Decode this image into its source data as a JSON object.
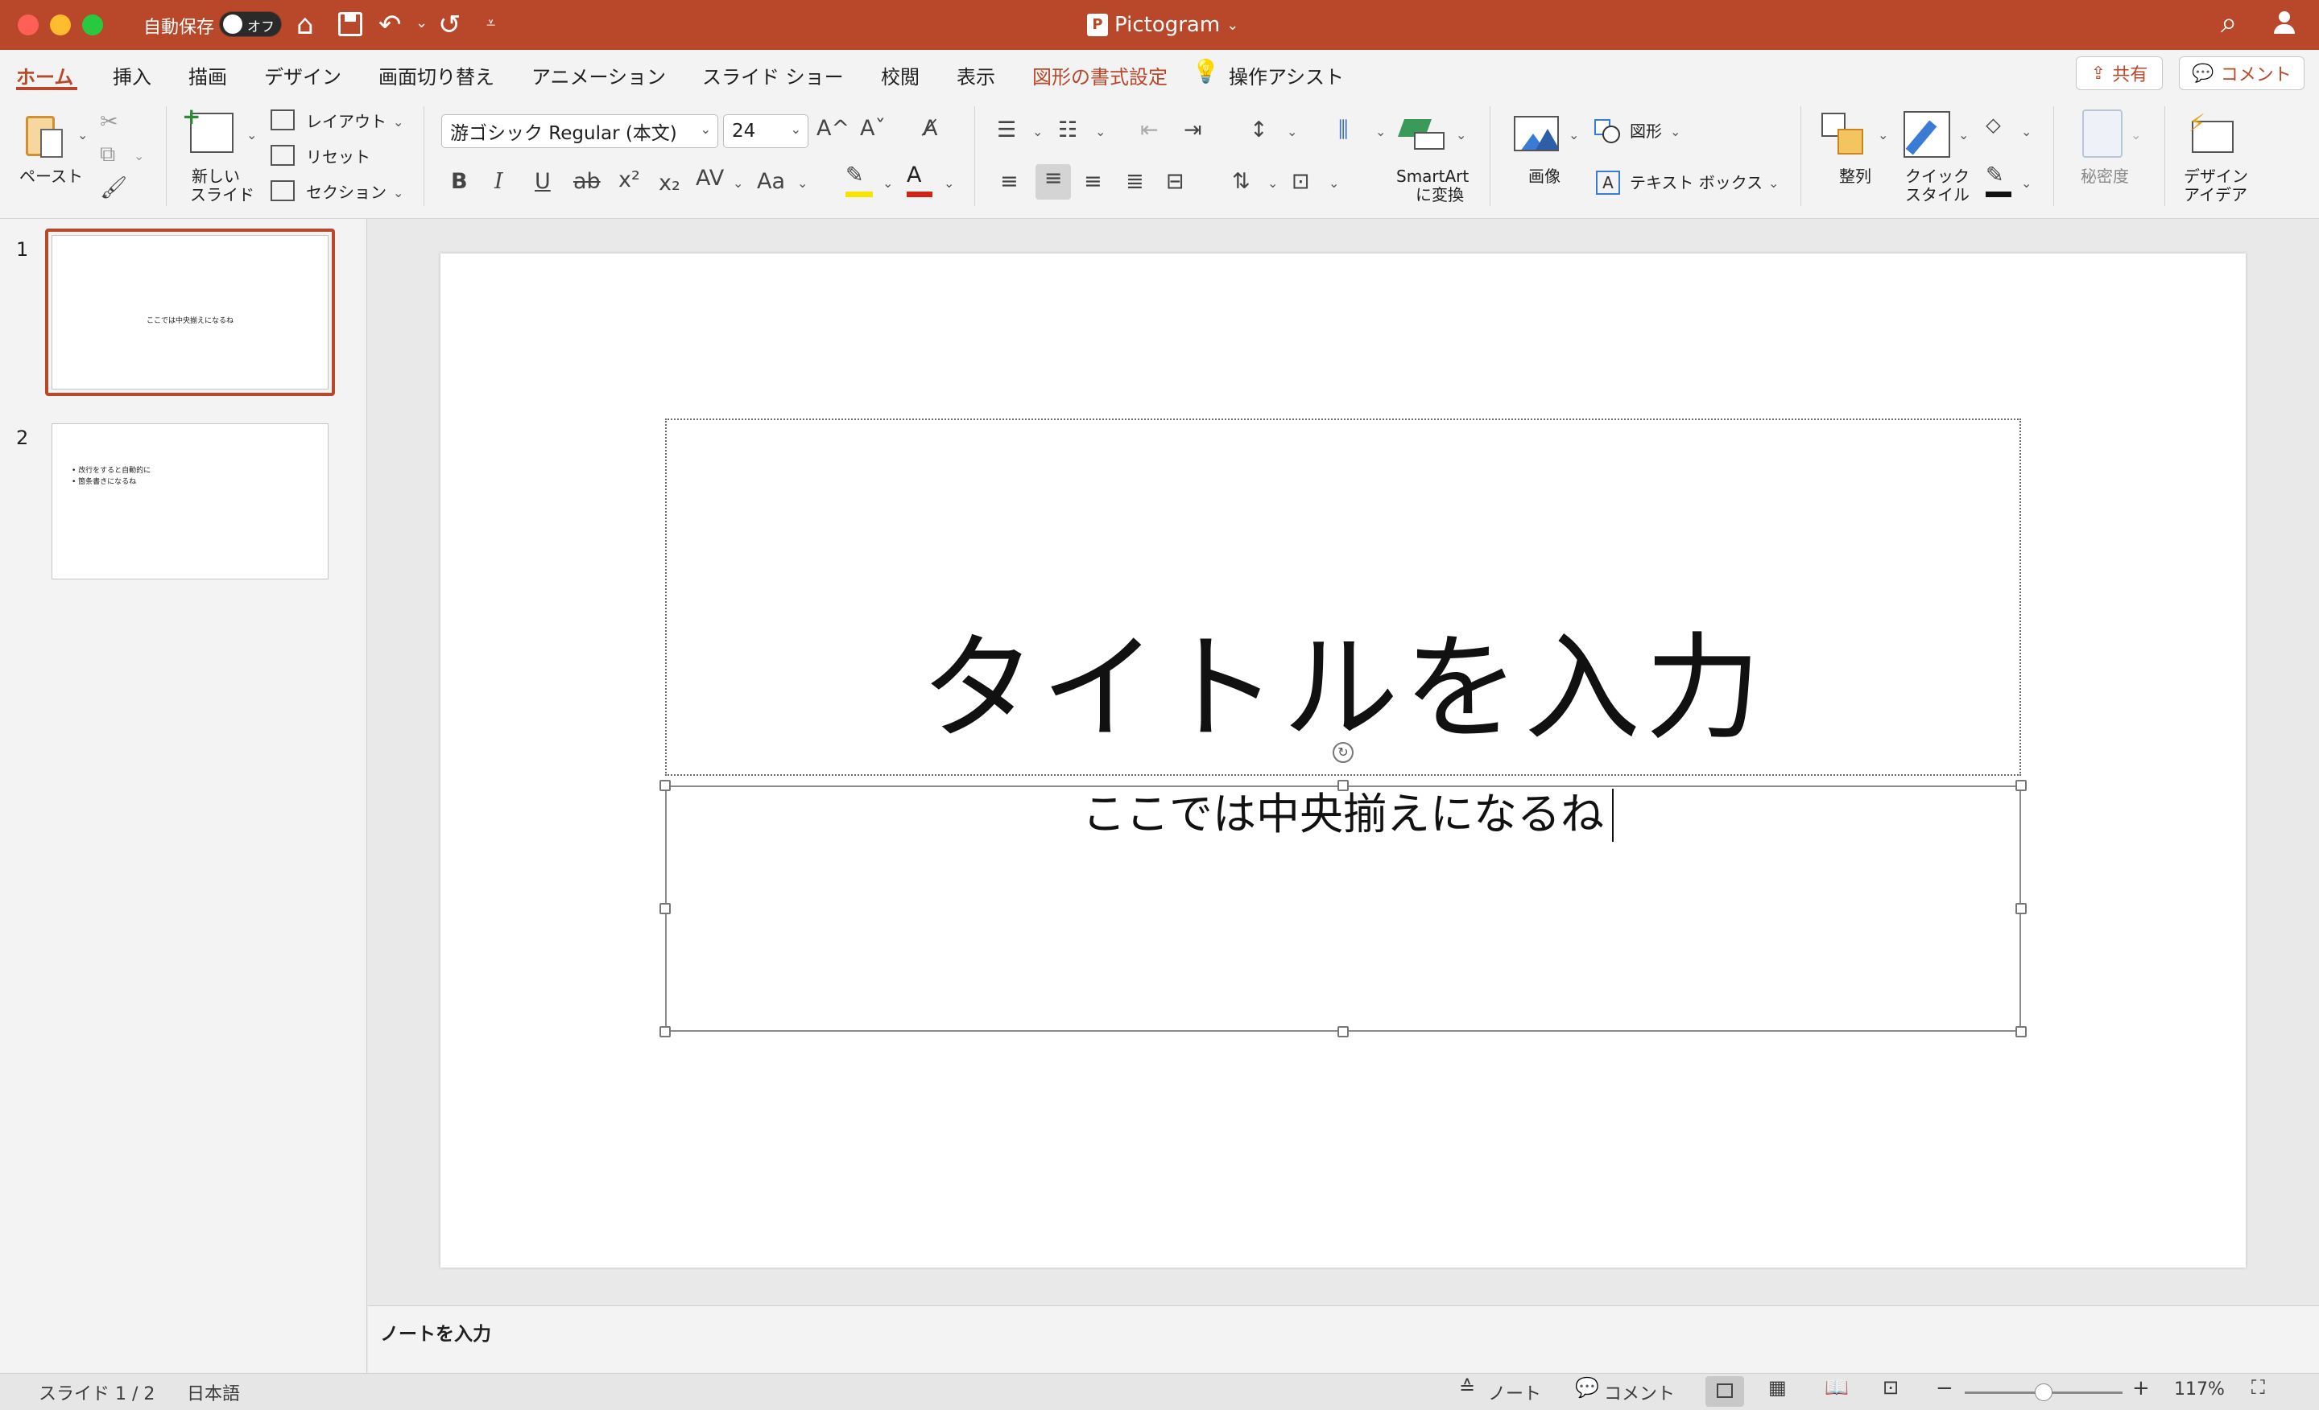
{
  "titlebar": {
    "autosave_label": "自動保存",
    "autosave_state": "オフ",
    "doc_title": "Pictogram",
    "doc_icon": "P",
    "home_icon": "⌂",
    "save_icon": "💾",
    "undo_icon": "↶",
    "redo_icon": "↺",
    "more_icon": "⌄",
    "search_icon": "⌕",
    "user_icon": "👤"
  },
  "tabs": {
    "items": [
      "ホーム",
      "挿入",
      "描画",
      "デザイン",
      "画面切り替え",
      "アニメーション",
      "スライド ショー",
      "校閲",
      "表示",
      "図形の書式設定"
    ],
    "tell_me": "操作アシスト",
    "share": "共有",
    "comments": "コメント"
  },
  "ribbon": {
    "paste": "ペースト",
    "new_slide_1": "新しい",
    "new_slide_2": "スライド",
    "layout": "レイアウト",
    "reset": "リセット",
    "section": "セクション",
    "font_name": "游ゴシック Regular (本文)",
    "font_size": "24",
    "bold": "B",
    "italic": "I",
    "underline": "U",
    "strike": "ab",
    "superscript": "x²",
    "subscript": "x₂",
    "spacing": "AV",
    "change_case": "Aa",
    "grow_font": "A^",
    "shrink_font": "Aˇ",
    "smartart_1": "SmartArt",
    "smartart_2": "に変換",
    "picture": "画像",
    "shapes": "図形",
    "textbox": "テキスト ボックス",
    "arrange": "整列",
    "quick_styles_1": "クイック",
    "quick_styles_2": "スタイル",
    "sensitivity": "秘密度",
    "design_ideas_1": "デザイン",
    "design_ideas_2": "アイデア",
    "highlight_color": "#f5e400",
    "font_color": "#d0241b"
  },
  "thumbnails": [
    {
      "num": "1",
      "text": "ここでは中央揃えになるね"
    },
    {
      "num": "2",
      "line1": "• 改行をすると自動的に",
      "line2": "• 箇条書きになるね"
    }
  ],
  "slide": {
    "title": "タイトルを入力",
    "subtitle": "ここでは中央揃えになるね"
  },
  "notes": {
    "placeholder": "ノートを入力"
  },
  "statusbar": {
    "slide_info": "スライド 1 / 2",
    "language": "日本語",
    "notes": "ノート",
    "comments": "コメント",
    "zoom": "117%"
  },
  "colors": {
    "accent": "#b9472a"
  }
}
